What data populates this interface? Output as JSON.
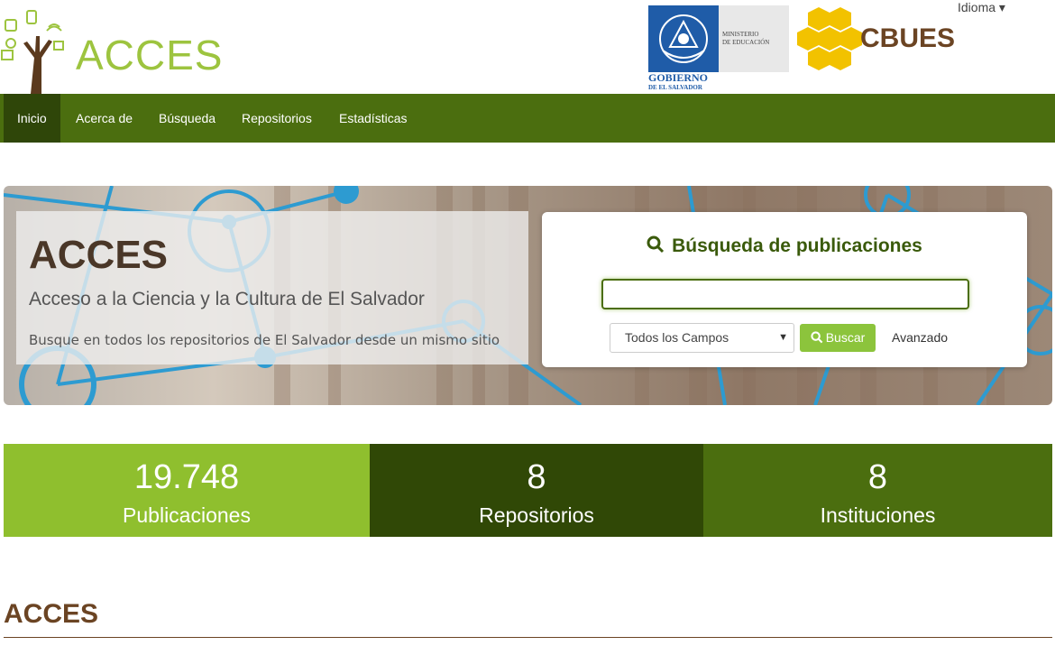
{
  "header": {
    "logo_text": "ACCES",
    "gov_ministerio": "MINISTERIO",
    "gov_educacion": "DE EDUCACIÓN",
    "gov_gobierno": "GOBIERNO",
    "gov_salvador": "DE EL SALVADOR",
    "partner_logo_text": "CBUES",
    "idioma_label": "Idioma ▾"
  },
  "nav": {
    "items": [
      {
        "label": "Inicio"
      },
      {
        "label": "Acerca de"
      },
      {
        "label": "Búsqueda"
      },
      {
        "label": "Repositorios"
      },
      {
        "label": "Estadísticas"
      }
    ]
  },
  "hero": {
    "title": "ACCES",
    "subtitle": "Acceso a la Ciencia y la Cultura de El Salvador",
    "description": "Busque en todos los repositorios de El Salvador desde un mismo sitio"
  },
  "search": {
    "title": "Búsqueda de publicaciones",
    "input_value": "",
    "select_value": "Todos los Campos",
    "button_label": "Buscar",
    "advanced_label": "Avanzado"
  },
  "stats": [
    {
      "number": "19.748",
      "label": "Publicaciones",
      "color": "#8fbf2e"
    },
    {
      "number": "8",
      "label": "Repositorios",
      "color": "#304806"
    },
    {
      "number": "8",
      "label": "Instituciones",
      "color": "#4b6e0f"
    }
  ],
  "section": {
    "title": "ACCES"
  },
  "colors": {
    "nav_bg": "#4b6e0f",
    "nav_active": "#2f4609",
    "accent_green": "#8cc43c",
    "brown": "#6b4423"
  }
}
